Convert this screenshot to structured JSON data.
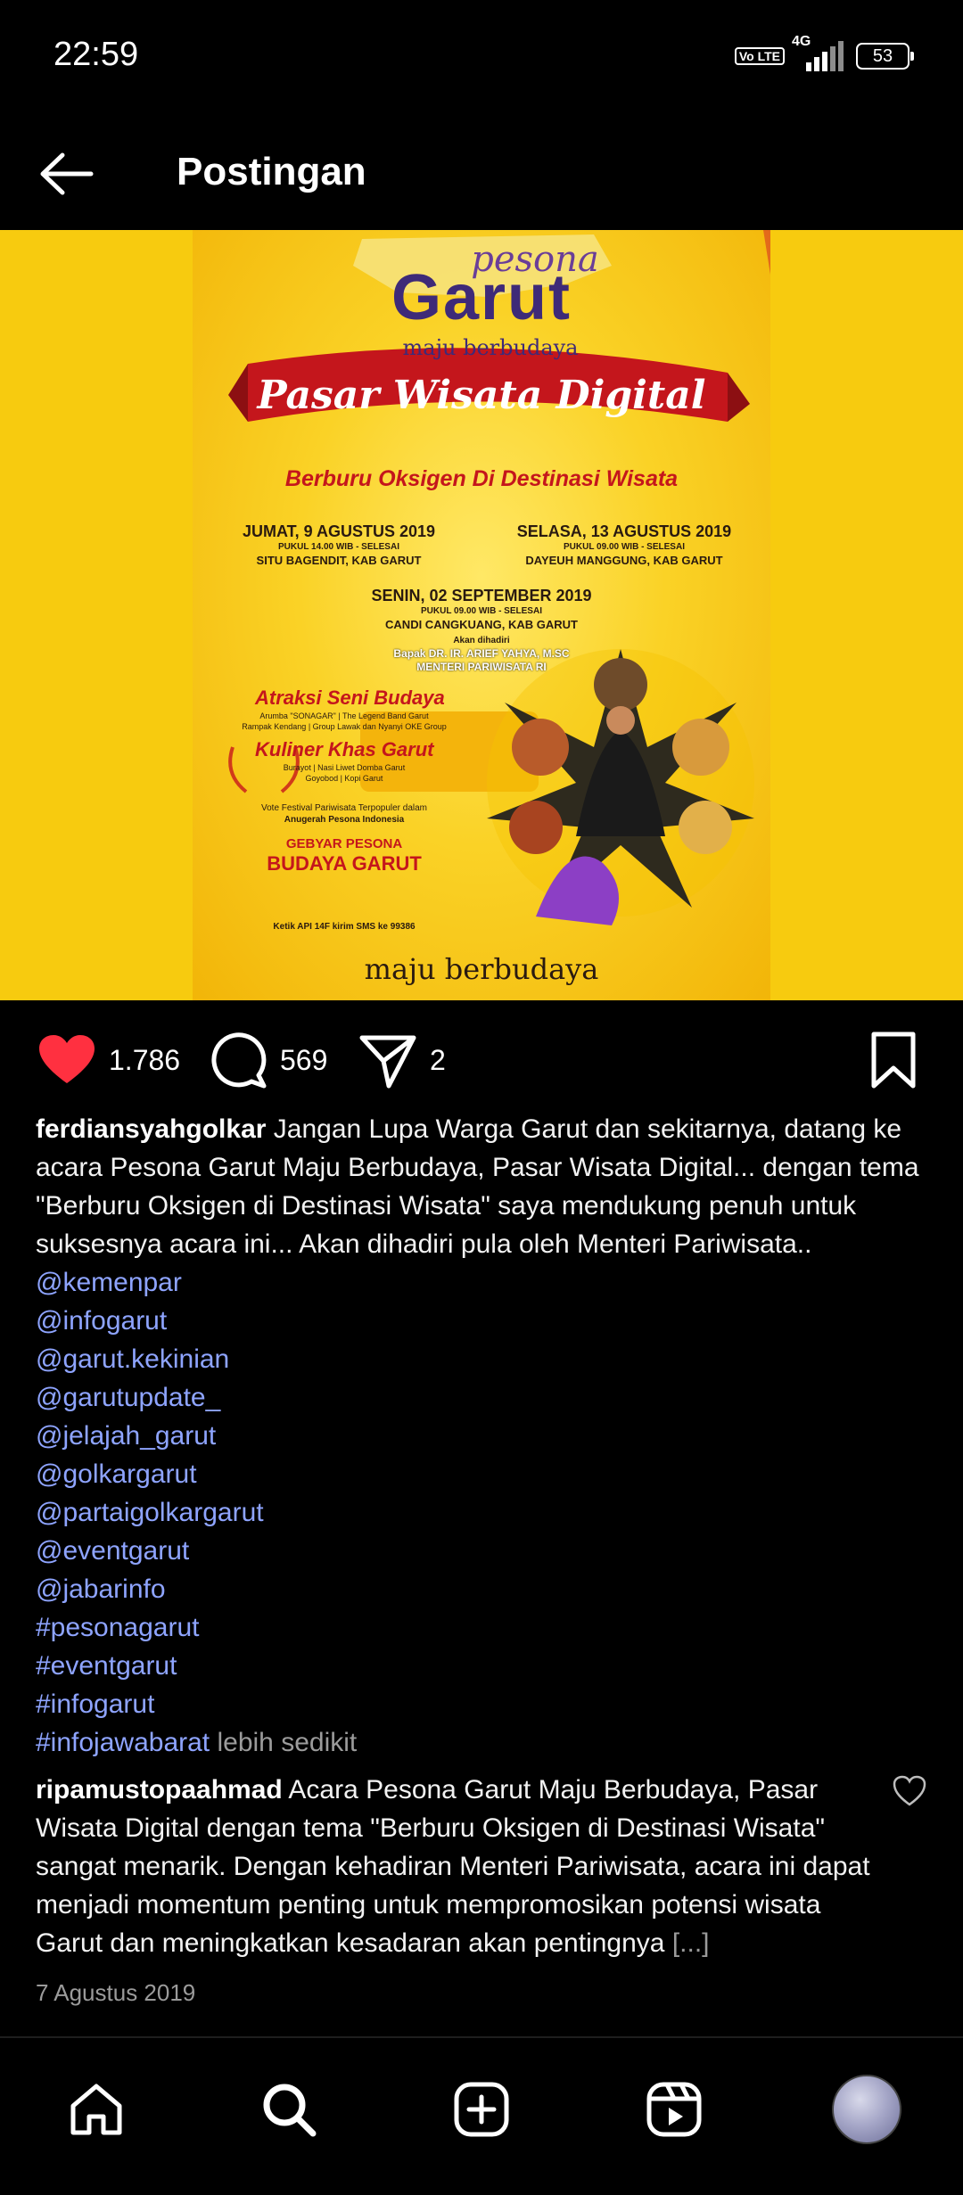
{
  "status_bar": {
    "time": "22:59",
    "volte": "Vo LTE",
    "network": "4G",
    "battery": "53"
  },
  "header": {
    "title": "Postingan"
  },
  "post": {
    "image": {
      "brand_top": "pesona",
      "brand_main": "Garut",
      "tagline": "maju berbudaya",
      "banner": "Pasar Wisata Digital",
      "subtitle": "Berburu Oksigen Di Destinasi Wisata",
      "event1_date": "JUMAT, 9 AGUSTUS 2019",
      "event1_time": "PUKUL 14.00 WIB - SELESAI",
      "event1_place": "SITU BAGENDIT, KAB GARUT",
      "event2_date": "SELASA, 13 AGUSTUS 2019",
      "event2_time": "PUKUL 09.00 WIB - SELESAI",
      "event2_place": "DAYEUH MANGGUNG, KAB GARUT",
      "event3_date": "SENIN, 02 SEPTEMBER 2019",
      "event3_time": "PUKUL 09.00 WIB - SELESAI",
      "event3_place": "CANDI CANGKUANG, KAB GARUT",
      "attended_label": "Akan dihadiri",
      "attended_name": "Bapak DR. IR. ARIEF YAHYA, M.SC",
      "attended_role": "MENTERI PARIWISATA RI",
      "section1_title": "Atraksi Seni Budaya",
      "section1_line1": "Arumba \"SONAGAR\" | The Legend Band Garut",
      "section1_line2": "Rampak Kendang | Group Lawak dan Nyanyi OKE Group",
      "section2_title": "Kuliner Khas Garut",
      "section2_line1": "Burayot | Nasi Liwet Domba Garut",
      "section2_line2": "Goyobod | Kopi Garut",
      "vote_line1": "Vote Festival Pariwisata Terpopuler dalam",
      "vote_line2": "Anugerah Pesona Indonesia",
      "gebyar_line1": "GEBYAR PESONA",
      "gebyar_line2": "BUDAYA GARUT",
      "sms": "Ketik API 14F kirim SMS ke 99386",
      "footer": "maju berbudaya"
    },
    "likes": "1.786",
    "comments": "569",
    "shares": "2",
    "author": "ferdiansyahgolkar",
    "caption": " Jangan Lupa Warga Garut dan sekitarnya, datang ke acara Pesona Garut Maju Berbudaya, Pasar Wisata Digital... dengan tema \"Berburu Oksigen di Destinasi Wisata\" saya mendukung penuh untuk suksesnya acara ini... Akan dihadiri pula oleh Menteri Pariwisata..",
    "tags": [
      "@kemenpar",
      "@infogarut",
      "@garut.kekinian",
      "@garutupdate_",
      "@jelajah_garut",
      "@golkargarut",
      "@partaigolkargarut",
      "@eventgarut",
      "@jabarinfo",
      "#pesonagarut",
      "#eventgarut",
      "#infogarut",
      "#infojawabarat"
    ],
    "less_label": " lebih sedikit",
    "date": "7 Agustus 2019"
  },
  "comment": {
    "author": "ripamustopaahmad",
    "text": " Acara Pesona Garut Maju Berbudaya, Pasar Wisata Digital dengan tema \"Berburu Oksigen di Destinasi Wisata\" sangat menarik. Dengan kehadiran Menteri Pariwisata, acara ini dapat menjadi momentum penting untuk mempromosikan potensi wisata Garut dan meningkatkan kesadaran akan pentingnya ",
    "ellipsis": "[...]"
  },
  "colors": {
    "link": "#8EA4FF",
    "like": "#FF3040",
    "poster_yellow": "#F7CB0F",
    "banner_red": "#C4161C"
  },
  "icons": [
    "back-arrow-icon",
    "heart-icon",
    "comment-icon",
    "share-icon",
    "bookmark-icon",
    "home-icon",
    "search-icon",
    "create-icon",
    "reels-icon",
    "profile-avatar"
  ]
}
